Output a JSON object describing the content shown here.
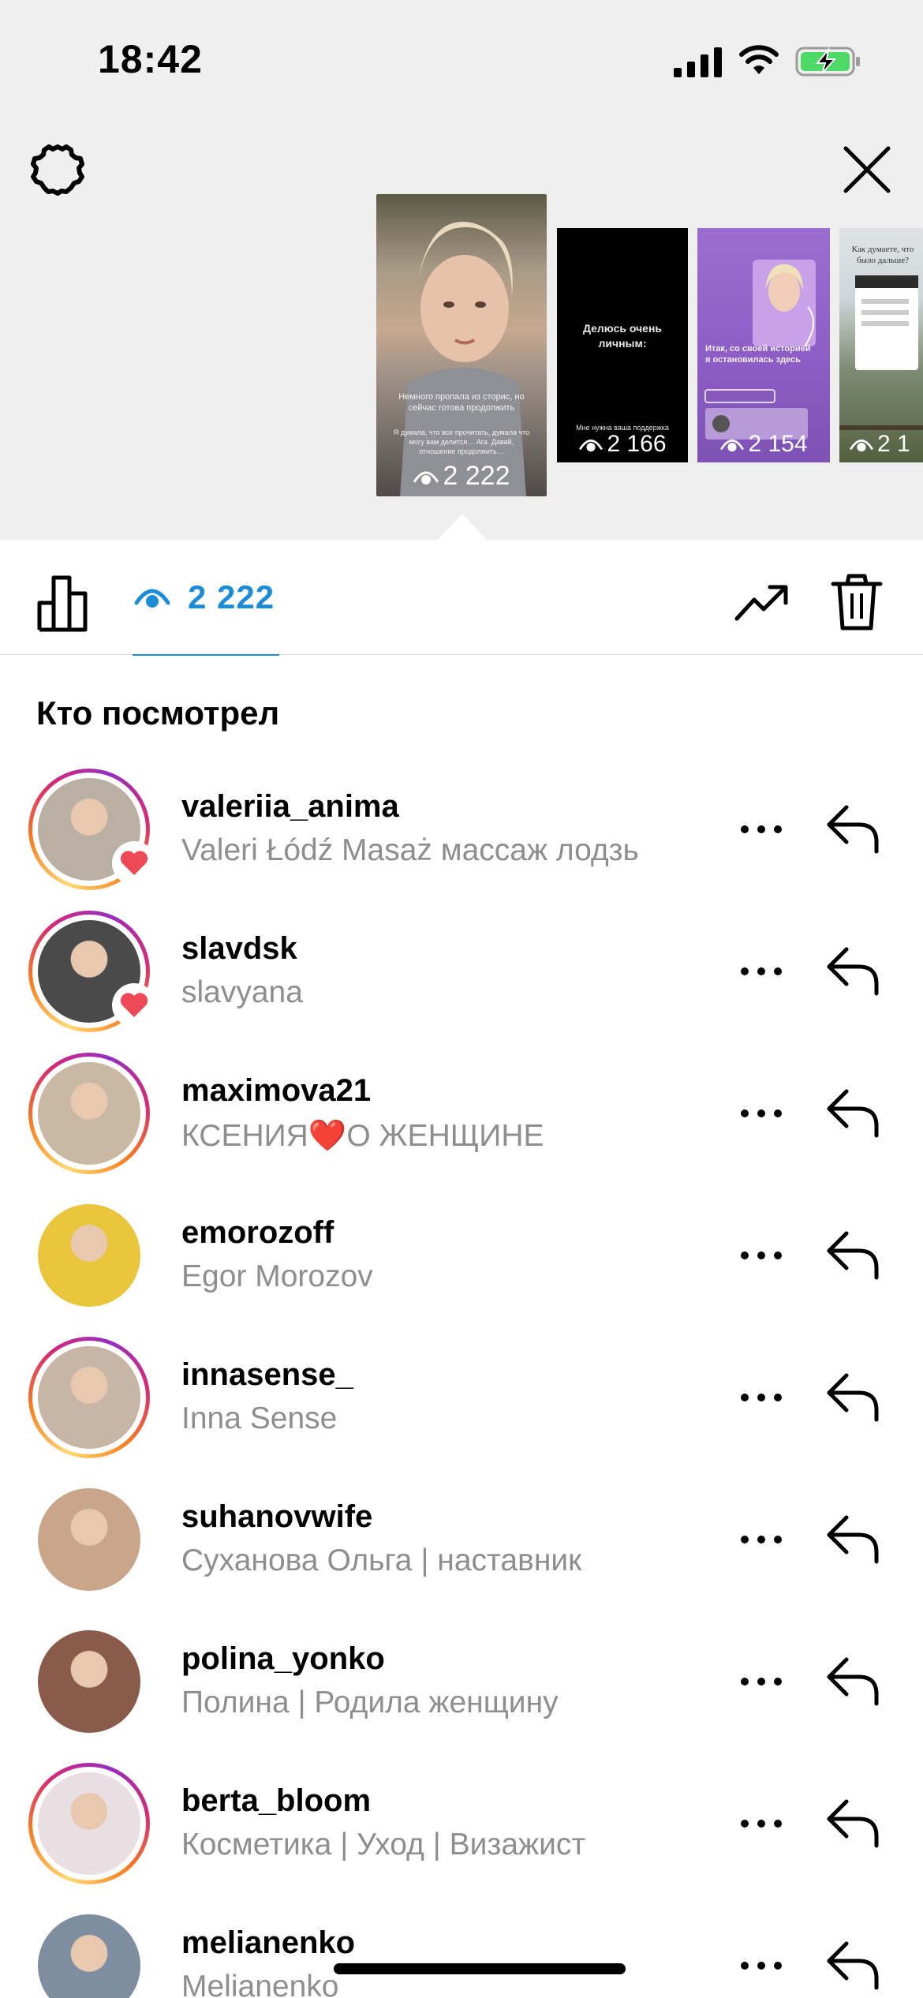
{
  "status_bar": {
    "time": "18:42"
  },
  "stories": [
    {
      "views": "2 222",
      "caption_top": "Немного пропала из сторис, но сейчас готова продолжить",
      "caption_bottom": "Я думала, что все прочитать, думала что могу вам делится… Ага. Давай, отношение продолжить…"
    },
    {
      "views": "2 166",
      "caption_top": "Делюсь очень личным:",
      "caption_bottom": "Мне нужна ваша поддержка"
    },
    {
      "views": "2 154",
      "caption_top": "Итак, со своей историей я остановилась здесь",
      "caption_bottom": ""
    },
    {
      "views": "2 1",
      "caption_top": "Как думаете, что было дальше?",
      "caption_bottom": ""
    }
  ],
  "toolbar": {
    "view_count": "2 222"
  },
  "section_title": "Кто посмотрел",
  "viewers": [
    {
      "username": "valeriia_anima",
      "fullname": "Valeri Łódź Masaż массаж лодзь",
      "ring": true,
      "liked": true,
      "avatar_color": "#b9b0a3"
    },
    {
      "username": "slavdsk",
      "fullname": "slavyana",
      "ring": true,
      "liked": true,
      "avatar_color": "#4a4a4a"
    },
    {
      "username": "maximova21",
      "fullname": "КСЕНИЯ❤️О ЖЕНЩИНЕ",
      "ring": true,
      "liked": false,
      "avatar_color": "#c9b9a4"
    },
    {
      "username": "emorozoff",
      "fullname": "Egor Morozov",
      "ring": false,
      "liked": false,
      "avatar_color": "#e8c53a"
    },
    {
      "username": "innasense_",
      "fullname": "Inna Sense",
      "ring": true,
      "liked": false,
      "avatar_color": "#c7b6a6"
    },
    {
      "username": "suhanovwife",
      "fullname": "Суханова Ольга | наставник",
      "ring": false,
      "liked": false,
      "avatar_color": "#c9a58a"
    },
    {
      "username": "polina_yonko",
      "fullname": "Полина | Родила женщину",
      "ring": false,
      "liked": false,
      "avatar_color": "#8a5a4a"
    },
    {
      "username": "berta_bloom",
      "fullname": "Косметика | Уход | Визажист",
      "ring": true,
      "liked": false,
      "avatar_color": "#e9dfe2"
    },
    {
      "username": "melianenko",
      "fullname": "Melianenko",
      "ring": false,
      "liked": false,
      "avatar_color": "#7f8da0"
    }
  ]
}
